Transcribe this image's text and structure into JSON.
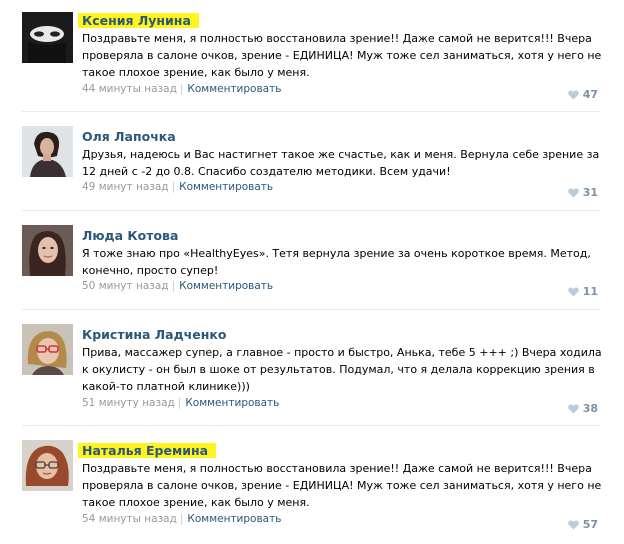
{
  "comments": [
    {
      "author": "Ксения Лунина",
      "text": "Поздравьте меня, я полностью восстановила зрение!! Даже самой не верится!!! Вчера проверяла в салоне очков, зрение - ЕДИНИЦА! Муж тоже сел заниматься, хотя у него не такое плохое зрение, как было у меня.",
      "time": "44 минуты назад",
      "reply": "Комментировать",
      "likes": "47",
      "avatar": "avatar-veiled-face"
    },
    {
      "author": "Оля Лапочка",
      "text": "Друзья, надеюсь и Вас настигнет такое же счастье, как и меня. Вернула себе зрение за 12 дней с -2 до 0.8. Спасибо создателю методики. Всем удачи!",
      "time": "49 минут назад",
      "reply": "Комментировать",
      "likes": "31",
      "avatar": "avatar-woman-dark-hair"
    },
    {
      "author": "Люда Котова",
      "text": "Я тоже знаю про «HealthyEyes». Тетя вернула зрение за очень короткое время. Метод, конечно, просто супер!",
      "time": "50 минут назад",
      "reply": "Комментировать",
      "likes": "11",
      "avatar": "avatar-woman-brown-hair"
    },
    {
      "author": "Кристина Ладченко",
      "text": "Привa, массажер супер, а главное - просто и быстро, Анька, тебе 5 +++ ;) Вчера ходила к окулисту - он был в шоке от результатов. Подумал, что я делала коррекцию зрения в какой-то платной клинике)))",
      "time": "51 минуту назад",
      "reply": "Комментировать",
      "likes": "38",
      "avatar": "avatar-woman-glasses"
    },
    {
      "author": "Наталья Еремина",
      "text": "Поздравьте меня, я полностью восстановила зрение!! Даже самой не верится!!! Вчера проверяла в салоне очков, зрение - ЕДИНИЦА! Муж тоже сел заниматься, хотя у него не такое плохое зрение, как было у меня.",
      "time": "54 минуты назад",
      "reply": "Комментировать",
      "likes": "57",
      "avatar": "avatar-woman-red-hair"
    }
  ],
  "colors": {
    "author": "#2b587a",
    "meta": "#999999",
    "highlight": "#fff41e",
    "likes": "#7b92a8"
  }
}
